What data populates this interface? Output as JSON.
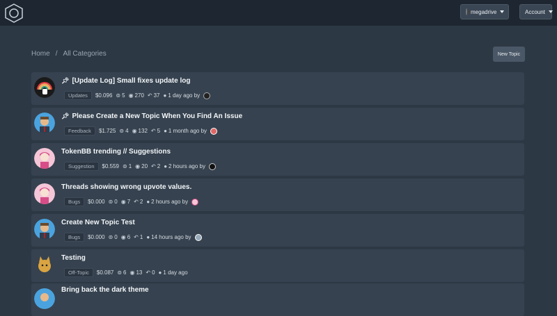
{
  "header": {
    "user_label": "megadrive",
    "account_label": "Account"
  },
  "breadcrumb": {
    "home": "Home",
    "separator": "/",
    "current": "All Categories"
  },
  "new_topic_label": "New Topic",
  "topics": [
    {
      "title": "[Update Log] Small fixes update log",
      "pinned": true,
      "category": "Updates",
      "value": "$0.096",
      "votes": "5",
      "views": "270",
      "replies": "37",
      "time": "1 day ago by"
    },
    {
      "title": "Please Create a New Topic When You Find An Issue",
      "pinned": true,
      "category": "Feedback",
      "value": "$1.725",
      "votes": "4",
      "views": "132",
      "replies": "5",
      "time": "1 month ago by"
    },
    {
      "title": "TokenBB trending // Suggestions",
      "pinned": false,
      "category": "Suggestion",
      "value": "$0.559",
      "votes": "1",
      "views": "20",
      "replies": "2",
      "time": "2 hours ago by"
    },
    {
      "title": "Threads showing wrong upvote values.",
      "pinned": false,
      "category": "Bugs",
      "value": "$0.000",
      "votes": "0",
      "views": "7",
      "replies": "2",
      "time": "2 hours ago by"
    },
    {
      "title": "Create New Topic Test",
      "pinned": false,
      "category": "Bugs",
      "value": "$0.000",
      "votes": "0",
      "views": "6",
      "replies": "1",
      "time": "14 hours ago by"
    },
    {
      "title": "Testing",
      "pinned": false,
      "category": "Off-Topic",
      "value": "$0.087",
      "votes": "6",
      "views": "13",
      "replies": "0",
      "time": "1 day ago"
    },
    {
      "title": "Bring back the dark theme",
      "pinned": false
    }
  ],
  "icons": {
    "pin": "pin-icon",
    "votes": "upvote-icon",
    "views": "eye-icon",
    "replies": "reply-icon",
    "time": "clock-icon"
  },
  "colors": {
    "background": "#2d3845",
    "topbar": "#1e2731",
    "card": "#36424f",
    "tag_bg": "#2b3541"
  }
}
